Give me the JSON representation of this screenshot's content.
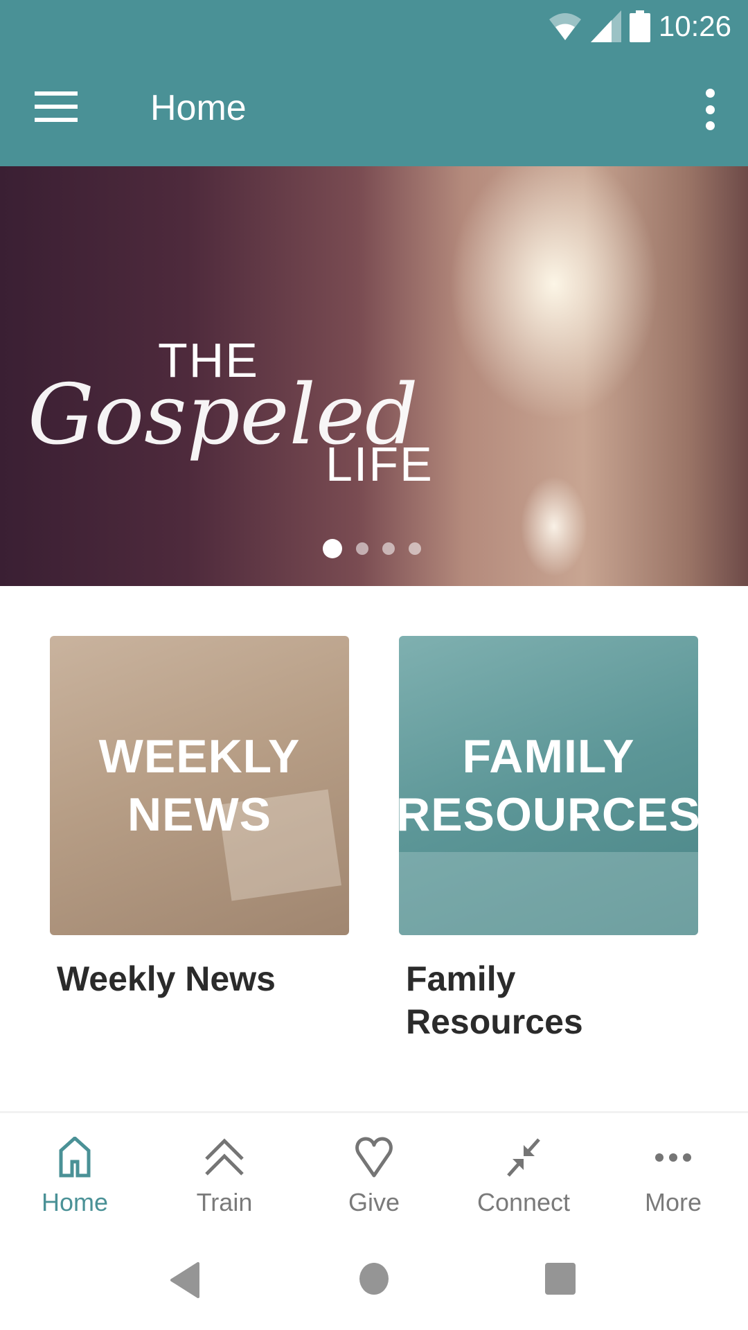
{
  "status_bar": {
    "time": "10:26",
    "icons": [
      "wifi-icon",
      "cell-signal-icon",
      "battery-icon"
    ]
  },
  "app_bar": {
    "title": "Home",
    "menu_icon": "hamburger-menu-icon",
    "overflow_icon": "more-vertical-icon"
  },
  "banner": {
    "line1": "THE",
    "line2": "Gospeled",
    "line3": "LIFE",
    "slide_count": 4,
    "active_slide": 1
  },
  "cards": [
    {
      "image_text": "WEEKLY\nNEWS",
      "title": "Weekly News"
    },
    {
      "image_text": "FAMILY\nRESOURCES",
      "title": "Family\nResources"
    }
  ],
  "bottom_nav": {
    "active": "Home",
    "items": [
      {
        "label": "Home",
        "icon": "home-icon"
      },
      {
        "label": "Train",
        "icon": "double-chevron-up-icon"
      },
      {
        "label": "Give",
        "icon": "heart-icon"
      },
      {
        "label": "Connect",
        "icon": "arrows-in-icon"
      },
      {
        "label": "More",
        "icon": "more-horizontal-icon"
      }
    ]
  },
  "colors": {
    "primary": "#4a9196",
    "nav_inactive": "#7a7a7a",
    "card_title": "#2b2b2b"
  }
}
